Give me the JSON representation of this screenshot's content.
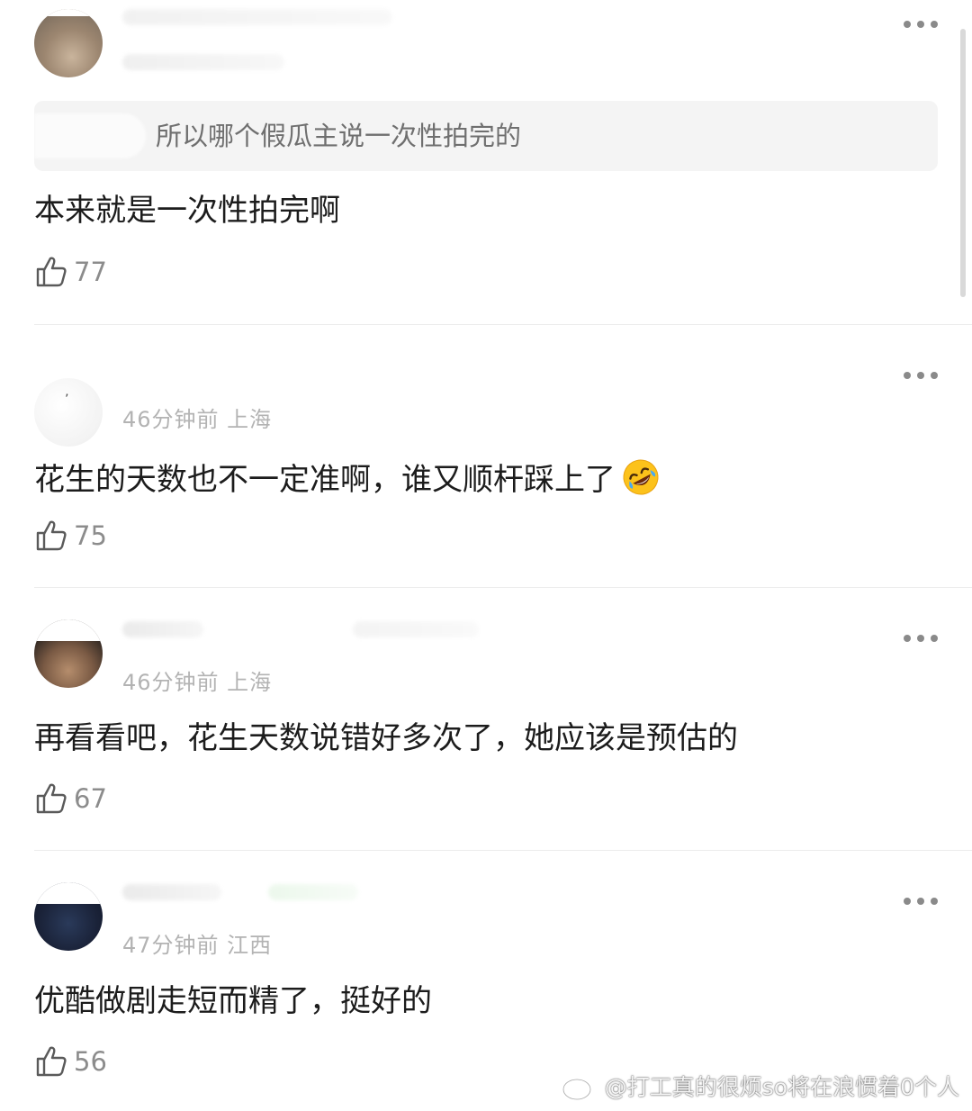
{
  "comments": [
    {
      "reply_to": "所以哪个假瓜主说一次性拍完的",
      "content": "本来就是一次性拍完啊",
      "likes": "77"
    },
    {
      "meta": "46分钟前 上海",
      "content": "花生的天数也不一定准啊，谁又顺杆踩上了",
      "emoji": "rolling-on-floor-laughing-emoji",
      "likes": "75"
    },
    {
      "meta": "46分钟前 上海",
      "content": "再看看吧，花生天数说错好多次了，她应该是预估的",
      "likes": "67"
    },
    {
      "meta": "47分钟前 江西",
      "content": "优酷做剧走短而精了，挺好的",
      "likes": "56"
    }
  ],
  "watermark": "@打工真的很烦so将在浪惯着0个人",
  "icons": {
    "more": "more-dots-icon",
    "like": "thumbs-up-icon",
    "watermark_logo": "weibo-logo-icon"
  },
  "colors": {
    "meta_text": "#b3b3b3",
    "like_count": "#8c8c8c",
    "quote_bg": "#f4f4f4"
  }
}
